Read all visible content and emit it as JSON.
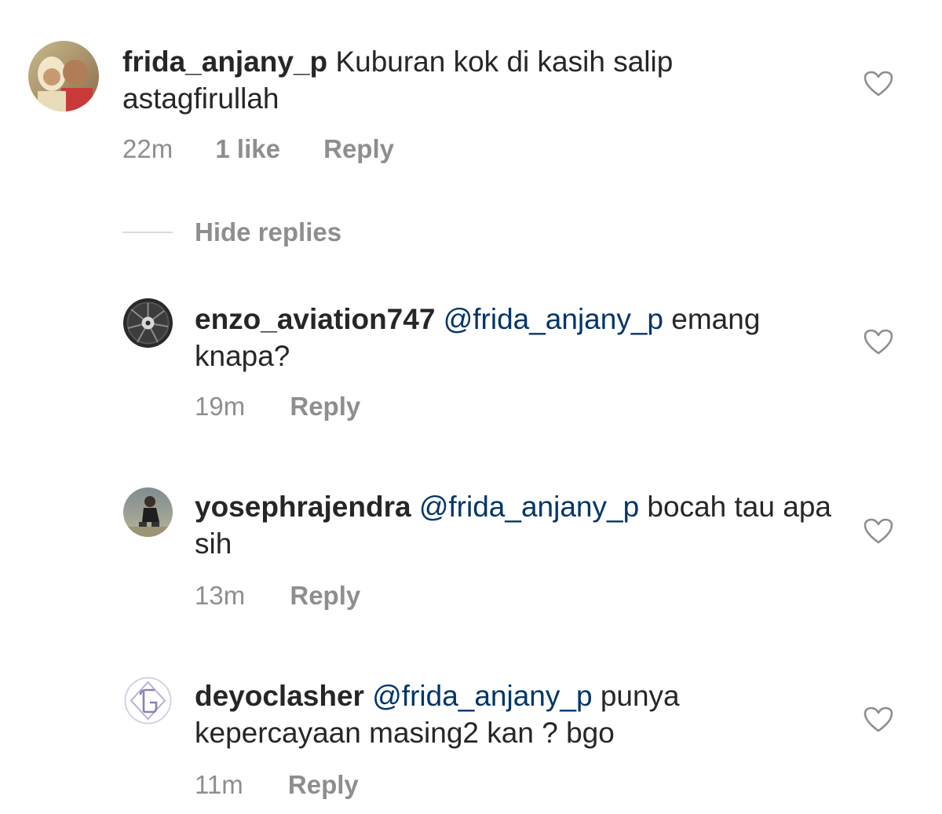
{
  "comments": [
    {
      "username": "frida_anjany_p",
      "mention": "",
      "text": "Kuburan kok di kasih salip astagfirullah",
      "time": "22m",
      "likes": "1 like",
      "reply_label": "Reply",
      "avatar_icon": "user-photo-avatar"
    }
  ],
  "hide_replies_label": "Hide replies",
  "replies": [
    {
      "username": "enzo_aviation747",
      "mention": "@frida_anjany_p",
      "text": " emang knapa?",
      "time": "19m",
      "reply_label": "Reply",
      "avatar_icon": "jet-engine-avatar"
    },
    {
      "username": "yosephrajendra",
      "mention": "@frida_anjany_p",
      "text": " bocah tau apa sih",
      "time": "13m",
      "reply_label": "Reply",
      "avatar_icon": "user-photo-avatar"
    },
    {
      "username": "deyoclasher",
      "mention": "@frida_anjany_p",
      "text": " punya kepercayaan masing2 kan ? bgo",
      "time": "11m",
      "reply_label": "Reply",
      "avatar_icon": "monogram-logo-avatar"
    }
  ],
  "colors": {
    "text": "#262626",
    "secondary": "#8e8e8e",
    "mention": "#003569",
    "divider": "#dbdbdb"
  }
}
